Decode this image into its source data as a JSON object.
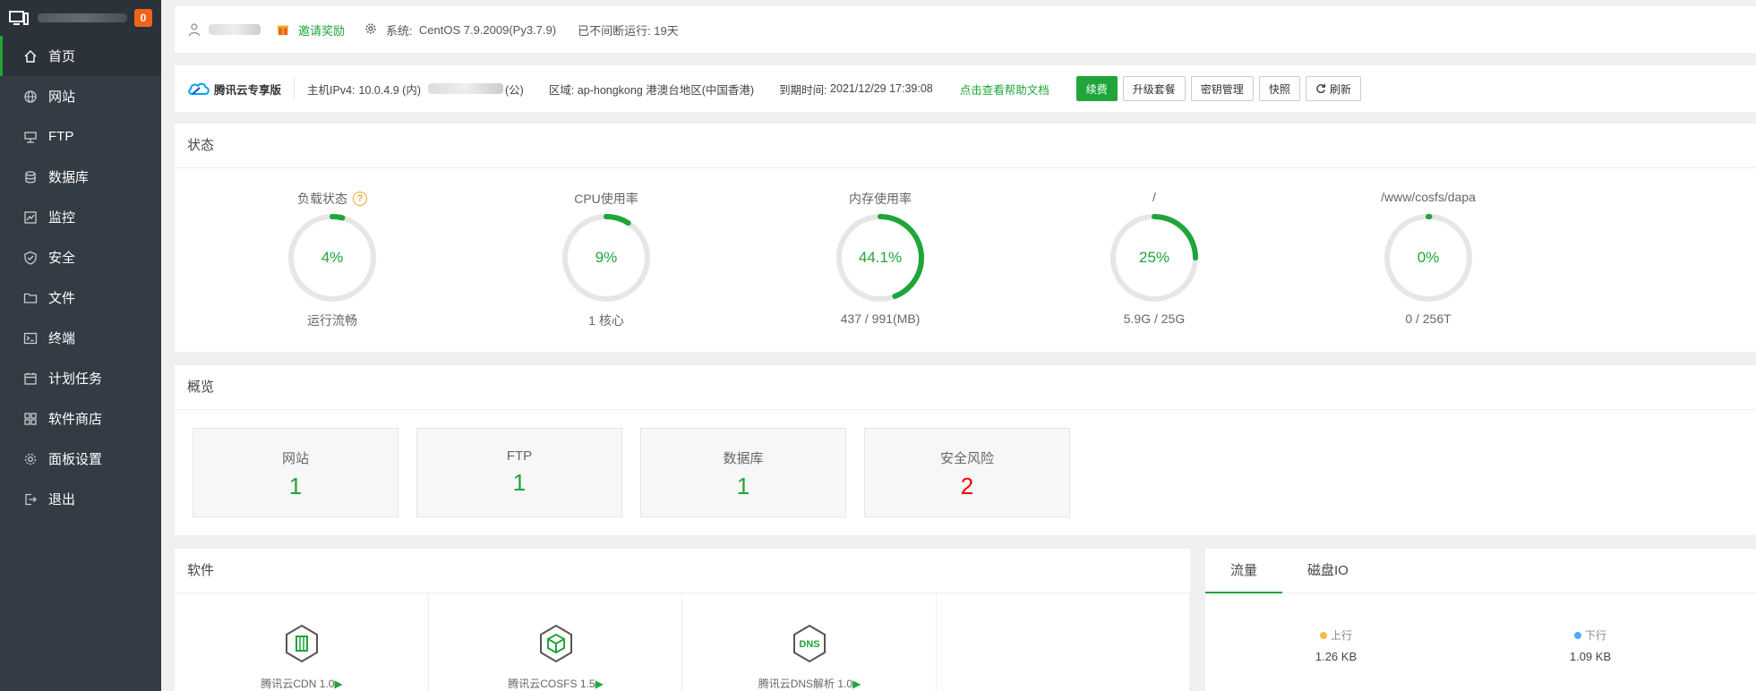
{
  "sidebar": {
    "badge": "0",
    "items": [
      {
        "label": "首页",
        "icon": "home-icon"
      },
      {
        "label": "网站",
        "icon": "globe-icon"
      },
      {
        "label": "FTP",
        "icon": "ftp-icon"
      },
      {
        "label": "数据库",
        "icon": "database-icon"
      },
      {
        "label": "监控",
        "icon": "monitor-icon"
      },
      {
        "label": "安全",
        "icon": "shield-icon"
      },
      {
        "label": "文件",
        "icon": "folder-icon"
      },
      {
        "label": "终端",
        "icon": "terminal-icon"
      },
      {
        "label": "计划任务",
        "icon": "calendar-icon"
      },
      {
        "label": "软件商店",
        "icon": "apps-icon"
      },
      {
        "label": "面板设置",
        "icon": "gear-icon"
      },
      {
        "label": "退出",
        "icon": "logout-icon"
      }
    ]
  },
  "infobar": {
    "invite": "邀请奖励",
    "system_label": "系统:",
    "system_value": "CentOS 7.9.2009(Py3.7.9)",
    "uptime": "已不间断运行: 19天"
  },
  "hostbar": {
    "brand": "腾讯云专享版",
    "ipv4_label": "主机IPv4:",
    "ipv4_value": "10.0.4.9 (内)",
    "public_suffix": "(公)",
    "region_label": "区域:",
    "region_value": "ap-hongkong 港澳台地区(中国香港)",
    "expire_label": "到期时间:",
    "expire_value": "2021/12/29 17:39:08",
    "help": "点击查看帮助文档",
    "buttons": {
      "renew": "续费",
      "upgrade": "升级套餐",
      "keys": "密钥管理",
      "snapshot": "快照",
      "refresh": "刷新"
    }
  },
  "status": {
    "title": "状态",
    "gauges": [
      {
        "label": "负载状态",
        "value": "4%",
        "fraction": 0.04,
        "sub": "运行流畅"
      },
      {
        "label": "CPU使用率",
        "value": "9%",
        "fraction": 0.09,
        "sub": "1 核心"
      },
      {
        "label": "内存使用率",
        "value": "44.1%",
        "fraction": 0.441,
        "sub": "437 / 991(MB)"
      },
      {
        "label": "/",
        "value": "25%",
        "fraction": 0.25,
        "sub": "5.9G / 25G"
      },
      {
        "label": "/www/cosfs/dapa",
        "value": "0%",
        "fraction": 0.0,
        "sub": "0 / 256T"
      }
    ]
  },
  "overview": {
    "title": "概览",
    "cards": [
      {
        "label": "网站",
        "value": "1"
      },
      {
        "label": "FTP",
        "value": "1"
      },
      {
        "label": "数据库",
        "value": "1"
      },
      {
        "label": "安全风险",
        "value": "2"
      }
    ]
  },
  "software": {
    "title": "软件",
    "items": [
      {
        "label": "腾讯云CDN 1.0",
        "icon": "cdn-icon"
      },
      {
        "label": "腾讯云COSFS 1.5",
        "icon": "cosfs-icon"
      },
      {
        "label": "腾讯云DNS解析 1.0",
        "icon": "dns-icon",
        "icon_text": "DNS"
      }
    ]
  },
  "traffic": {
    "tabs": [
      "流量",
      "磁盘IO"
    ],
    "up_label": "上行",
    "up_value": "1.26 KB",
    "down_label": "下行",
    "down_value": "1.09 KB"
  },
  "colors": {
    "accent": "#20a53a",
    "danger": "#ff0000",
    "sidebar": "#333c44",
    "up": "#f7b851",
    "down": "#52a9ff"
  }
}
